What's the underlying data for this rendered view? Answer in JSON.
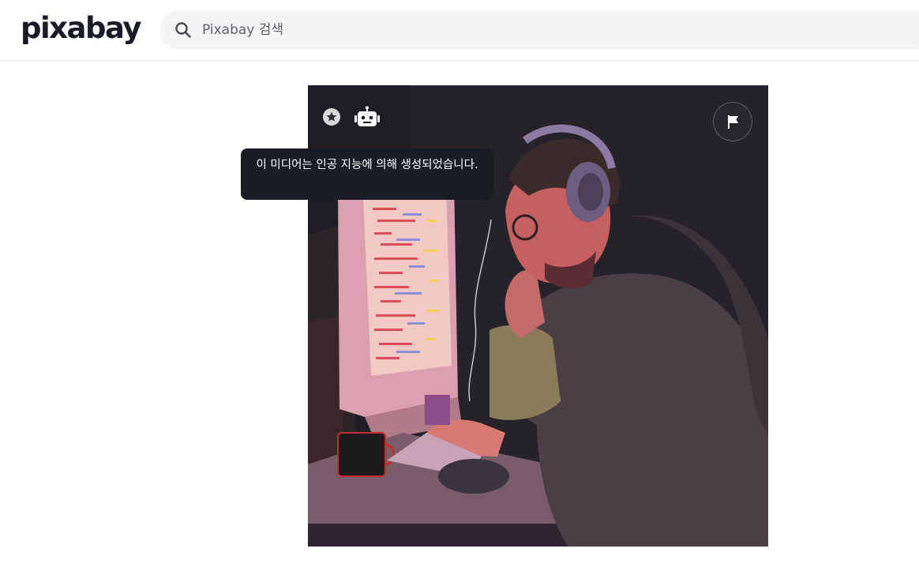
{
  "header": {
    "logo_text": "pixabay",
    "search": {
      "placeholder": "Pixabay 검색",
      "value": "",
      "icon": "search-icon"
    }
  },
  "media": {
    "badges": {
      "first_icon": "star-badge-icon",
      "ai_icon": "robot-icon"
    },
    "tooltip_text": "이 미디어는 인공 지능에 의해 생성되었습니다.",
    "flag_button_icon": "flag-icon"
  },
  "colors": {
    "text_dark": "#191b26",
    "search_bg": "#f5f5f5",
    "tooltip_bg": "#191b26",
    "header_border": "#e6e6e6"
  }
}
